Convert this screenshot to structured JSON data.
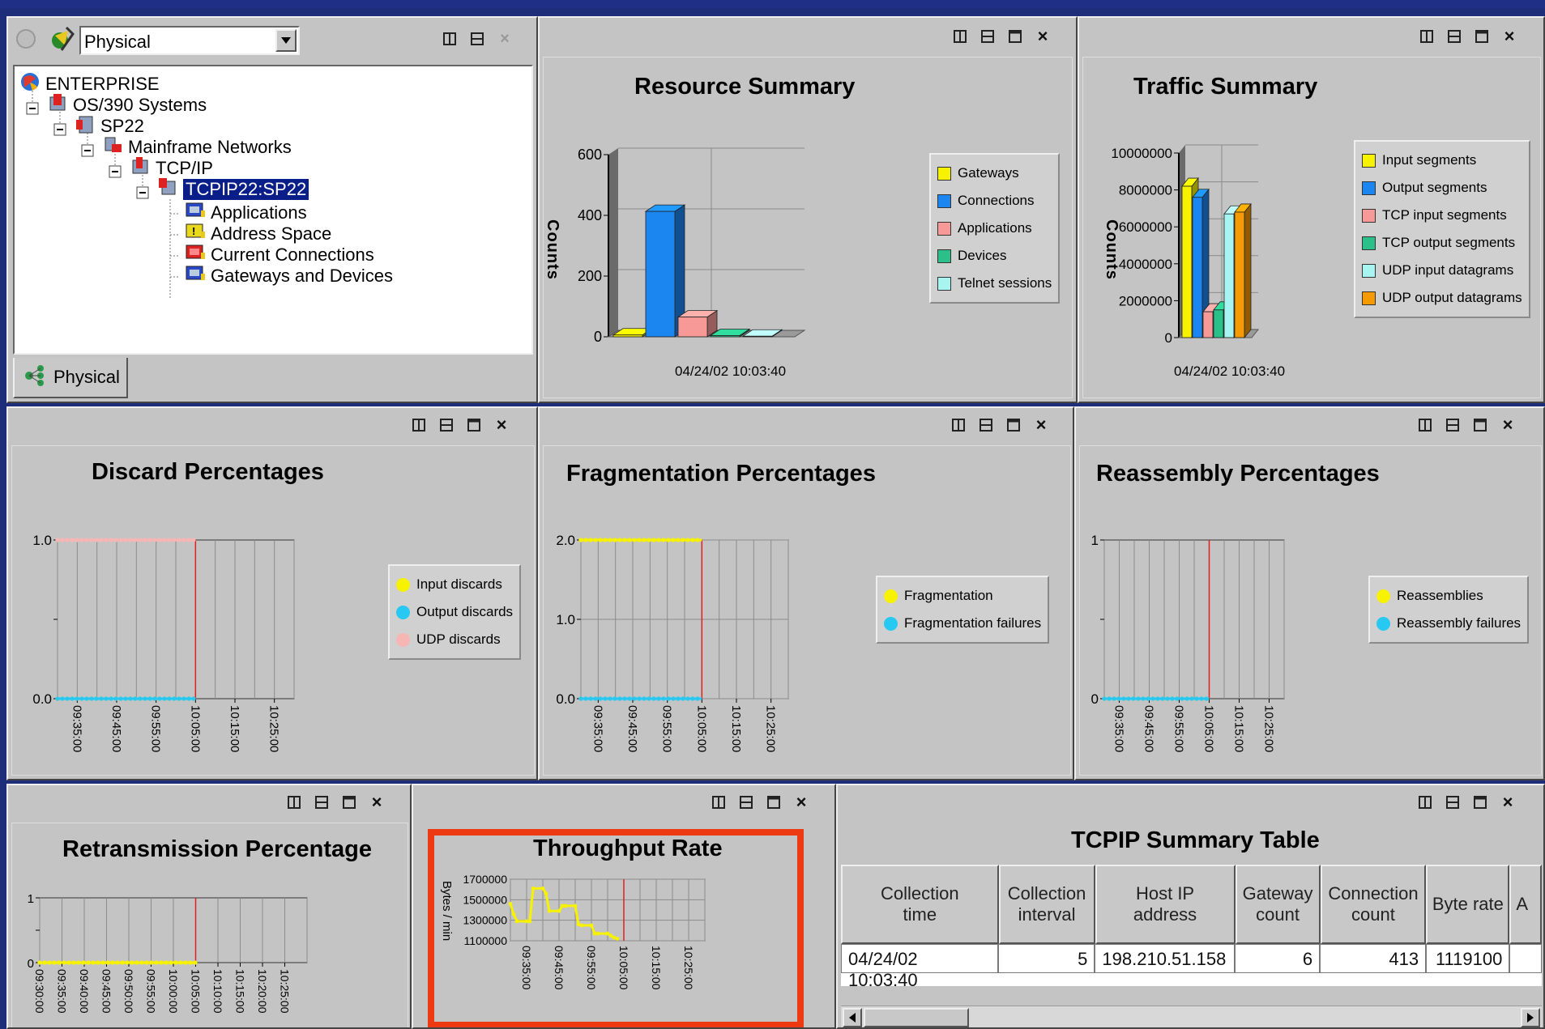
{
  "navigator": {
    "view_select": "Physical",
    "tab_label": "Physical",
    "tree": [
      {
        "label": "ENTERPRISE",
        "level": 0,
        "icon": "globe-icon"
      },
      {
        "label": "OS/390 Systems",
        "level": 1,
        "icon": "systems-icon"
      },
      {
        "label": "SP22",
        "level": 2,
        "icon": "system-icon"
      },
      {
        "label": "Mainframe Networks",
        "level": 3,
        "icon": "network-icon"
      },
      {
        "label": "TCP/IP",
        "level": 4,
        "icon": "tcpip-icon"
      },
      {
        "label": "TCPIP22:SP22",
        "level": 5,
        "icon": "tcpip-node-icon",
        "selected": true
      },
      {
        "label": "Applications",
        "level": 6,
        "icon": "workspace-icon"
      },
      {
        "label": "Address Space",
        "level": 6,
        "icon": "warning-workspace-icon"
      },
      {
        "label": "Current Connections",
        "level": 6,
        "icon": "alert-workspace-icon"
      },
      {
        "label": "Gateways and Devices",
        "level": 6,
        "icon": "workspace-icon"
      }
    ]
  },
  "resource_summary": {
    "title": "Resource Summary",
    "ylabel": "Counts",
    "xlabel": "04/24/02 10:03:40",
    "legend": [
      {
        "label": "Gateways",
        "color": "#f6f200"
      },
      {
        "label": "Connections",
        "color": "#1c86f0"
      },
      {
        "label": "Applications",
        "color": "#f79a97"
      },
      {
        "label": "Devices",
        "color": "#2bbf8a"
      },
      {
        "label": "Telnet sessions",
        "color": "#a8f4f0"
      }
    ]
  },
  "traffic_summary": {
    "title": "Traffic Summary",
    "ylabel": "Counts",
    "xlabel": "04/24/02 10:03:40",
    "legend": [
      {
        "label": "Input segments",
        "color": "#f6f200"
      },
      {
        "label": "Output segments",
        "color": "#1c86f0"
      },
      {
        "label": "TCP input segments",
        "color": "#f79a97"
      },
      {
        "label": "TCP output segments",
        "color": "#2bbf8a"
      },
      {
        "label": "UDP input datagrams",
        "color": "#a8f4f0"
      },
      {
        "label": "UDP output datagrams",
        "color": "#f59a00"
      }
    ]
  },
  "discard": {
    "title": "Discard Percentages",
    "legend": [
      {
        "label": "Input discards",
        "color": "#f6f200"
      },
      {
        "label": "Output discards",
        "color": "#27c8f2"
      },
      {
        "label": "UDP discards",
        "color": "#f7b6b4"
      }
    ]
  },
  "fragmentation": {
    "title": "Fragmentation Percentages",
    "legend": [
      {
        "label": "Fragmentation",
        "color": "#f6f200"
      },
      {
        "label": "Fragmentation failures",
        "color": "#27c8f2"
      }
    ]
  },
  "reassembly": {
    "title": "Reassembly Percentages",
    "legend": [
      {
        "label": "Reassemblies",
        "color": "#f6f200"
      },
      {
        "label": "Reassembly failures",
        "color": "#27c8f2"
      }
    ]
  },
  "retransmission": {
    "title": "Retransmission Percentage"
  },
  "throughput": {
    "title": "Throughput Rate",
    "ylabel": "Bytes / min"
  },
  "summary_table": {
    "title": "TCPIP Summary Table",
    "columns": [
      "Collection time",
      "Collection interval",
      "Host IP address",
      "Gateway count",
      "Connection count",
      "Byte rate",
      "A"
    ],
    "rows": [
      [
        "04/24/02 10:03:40",
        "5",
        "198.210.51.158",
        "6",
        "413",
        "1119100",
        ""
      ]
    ]
  },
  "chart_data": [
    {
      "type": "bar",
      "name": "Resource Summary",
      "title": "Resource Summary",
      "ylabel": "Counts",
      "categories": [
        "04/24/02 10:03:40"
      ],
      "series": [
        {
          "name": "Gateways",
          "values": [
            6
          ]
        },
        {
          "name": "Connections",
          "values": [
            413
          ]
        },
        {
          "name": "Applications",
          "values": [
            65
          ]
        },
        {
          "name": "Devices",
          "values": [
            4
          ]
        },
        {
          "name": "Telnet sessions",
          "values": [
            2
          ]
        }
      ],
      "yticks": [
        0,
        200,
        400,
        600
      ],
      "ylim": [
        0,
        600
      ],
      "legend": "right"
    },
    {
      "type": "bar",
      "name": "Traffic Summary",
      "title": "Traffic Summary",
      "ylabel": "Counts",
      "categories": [
        "04/24/02 10:03:40"
      ],
      "series": [
        {
          "name": "Input segments",
          "values": [
            8200000
          ]
        },
        {
          "name": "Output segments",
          "values": [
            7600000
          ]
        },
        {
          "name": "TCP input segments",
          "values": [
            1400000
          ]
        },
        {
          "name": "TCP output segments",
          "values": [
            1500000
          ]
        },
        {
          "name": "UDP input datagrams",
          "values": [
            6700000
          ]
        },
        {
          "name": "UDP output datagrams",
          "values": [
            6800000
          ]
        }
      ],
      "yticks": [
        0,
        2000000,
        4000000,
        6000000,
        8000000,
        10000000
      ],
      "ylim": [
        0,
        10000000
      ],
      "legend": "right"
    },
    {
      "type": "line",
      "name": "Discard Percentages",
      "title": "Discard Percentages",
      "xticks": [
        "09:35:00",
        "09:45:00",
        "09:55:00",
        "10:05:00",
        "10:15:00",
        "10:25:00"
      ],
      "yticks": [
        "0.0",
        "1.0"
      ],
      "ylim": [
        0,
        1
      ],
      "series": [
        {
          "name": "Input discards",
          "x": [
            "09:30:00",
            "10:05:00"
          ],
          "values": [
            0,
            0
          ]
        },
        {
          "name": "Output discards",
          "x": [
            "09:30:00",
            "10:05:00"
          ],
          "values": [
            0,
            0
          ]
        },
        {
          "name": "UDP discards",
          "x": [
            "09:30:00",
            "10:05:00"
          ],
          "values": [
            1,
            1
          ]
        }
      ],
      "legend": "right"
    },
    {
      "type": "line",
      "name": "Fragmentation Percentages",
      "title": "Fragmentation Percentages",
      "xticks": [
        "09:35:00",
        "09:45:00",
        "09:55:00",
        "10:05:00",
        "10:15:00",
        "10:25:00"
      ],
      "yticks": [
        "0.0",
        "1.0",
        "2.0"
      ],
      "ylim": [
        0,
        2
      ],
      "series": [
        {
          "name": "Fragmentation",
          "x": [
            "09:30:00",
            "10:05:00"
          ],
          "values": [
            2,
            2
          ]
        },
        {
          "name": "Fragmentation failures",
          "x": [
            "09:30:00",
            "10:05:00"
          ],
          "values": [
            0,
            0
          ]
        }
      ],
      "legend": "right"
    },
    {
      "type": "line",
      "name": "Reassembly Percentages",
      "title": "Reassembly Percentages",
      "xticks": [
        "09:35:00",
        "09:45:00",
        "09:55:00",
        "10:05:00",
        "10:15:00",
        "10:25:00"
      ],
      "yticks": [
        "0",
        "1"
      ],
      "ylim": [
        0,
        1
      ],
      "series": [
        {
          "name": "Reassemblies",
          "x": [
            "09:30:00",
            "10:05:00"
          ],
          "values": [
            0,
            0
          ]
        },
        {
          "name": "Reassembly failures",
          "x": [
            "09:30:00",
            "10:05:00"
          ],
          "values": [
            0,
            0
          ]
        }
      ],
      "legend": "right"
    },
    {
      "type": "line",
      "name": "Retransmission Percentage",
      "title": "Retransmission Percentage",
      "xticks": [
        "09:30:00",
        "09:35:00",
        "09:40:00",
        "09:45:00",
        "09:50:00",
        "09:55:00",
        "10:00:00",
        "10:05:00",
        "10:10:00",
        "10:15:00",
        "10:20:00",
        "10:25:00"
      ],
      "yticks": [
        "0",
        "1"
      ],
      "ylim": [
        0,
        1
      ],
      "series": [
        {
          "name": "Retransmission",
          "x": [
            "09:30:00",
            "10:05:00"
          ],
          "values": [
            0,
            0
          ]
        }
      ]
    },
    {
      "type": "line",
      "name": "Throughput Rate",
      "title": "Throughput Rate",
      "ylabel": "Bytes / min",
      "xticks": [
        "09:35:00",
        "09:45:00",
        "09:55:00",
        "10:05:00",
        "10:15:00",
        "10:25:00"
      ],
      "yticks": [
        1100000,
        1300000,
        1500000,
        1700000
      ],
      "ylim": [
        1100000,
        1700000
      ],
      "series": [
        {
          "name": "Throughput",
          "x": [
            "09:30",
            "09:31",
            "09:32",
            "09:35",
            "09:36",
            "09:37",
            "09:40",
            "09:41",
            "09:42",
            "09:45",
            "09:46",
            "09:47",
            "09:50",
            "09:51",
            "09:52",
            "09:55",
            "09:56",
            "09:57",
            "10:00",
            "10:01",
            "10:02",
            "10:03"
          ],
          "values": [
            1460000,
            1360000,
            1290000,
            1290000,
            1290000,
            1610000,
            1610000,
            1560000,
            1390000,
            1390000,
            1440000,
            1440000,
            1440000,
            1260000,
            1250000,
            1250000,
            1170000,
            1170000,
            1170000,
            1150000,
            1130000,
            1120000
          ]
        }
      ]
    }
  ]
}
